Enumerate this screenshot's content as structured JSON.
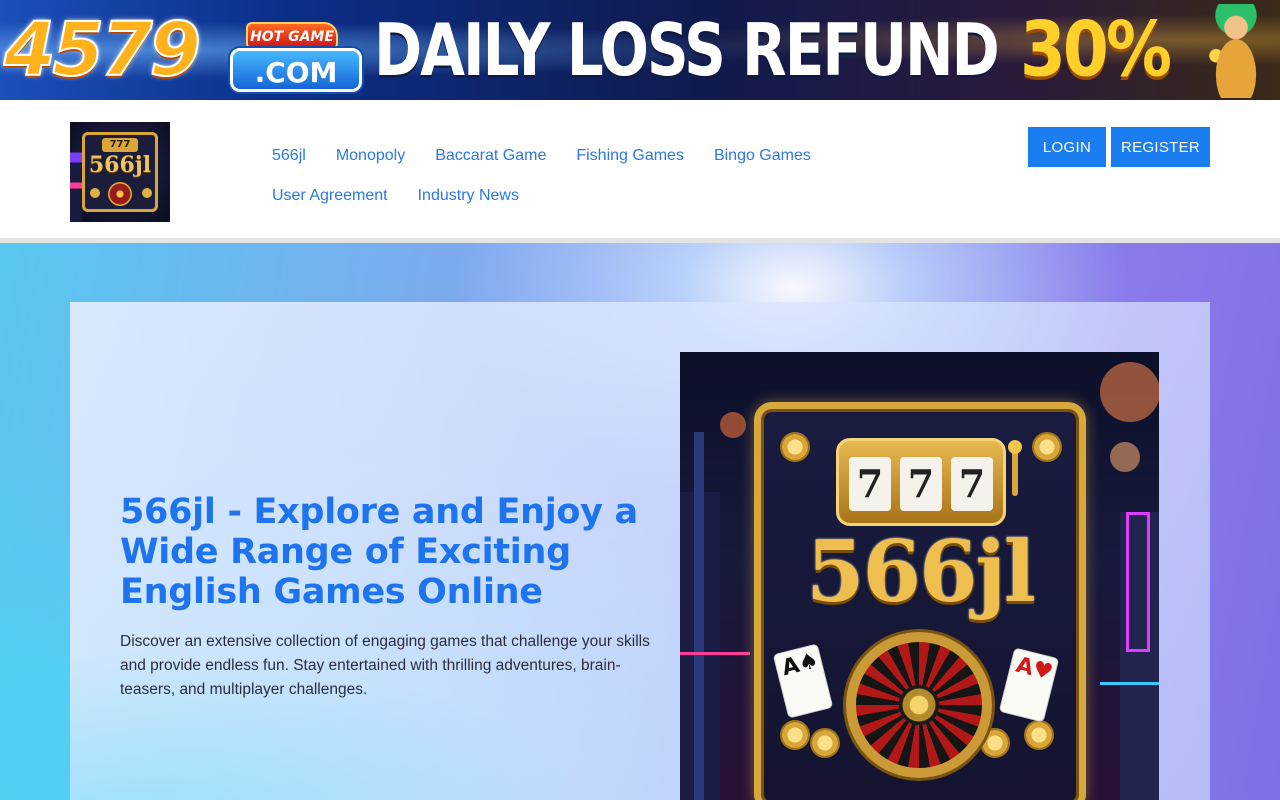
{
  "banner": {
    "brand_number": "4579",
    "hot_game": "HOT GAME",
    "dotcom": ".COM",
    "headline": "DAILY LOSS REFUND",
    "percent": "30%"
  },
  "header": {
    "logo": {
      "badge": "777",
      "text": "566jl"
    },
    "nav": {
      "row1": [
        "566jl",
        "Monopoly",
        "Baccarat Game",
        "Fishing Games",
        "Bingo Games"
      ],
      "row2": [
        "User Agreement",
        "Industry News"
      ]
    },
    "login_label": "LOGIN",
    "register_label": "REGISTER"
  },
  "hero": {
    "title": "566jl - Explore and Enjoy a Wide Range of Exciting English Games Online",
    "description": "Discover an extensive collection of engaging games that challenge your skills and provide endless fun. Stay entertained with thrilling adventures, brain-teasers, and multiplayer challenges.",
    "poster": {
      "reels": [
        "7",
        "7",
        "7"
      ],
      "brand": "566jl",
      "card_left": "A♠",
      "card_right": "A♥"
    }
  },
  "colors": {
    "accent": "#1a7ef0",
    "nav_link": "#2b78e6",
    "title": "#1d74ee"
  }
}
